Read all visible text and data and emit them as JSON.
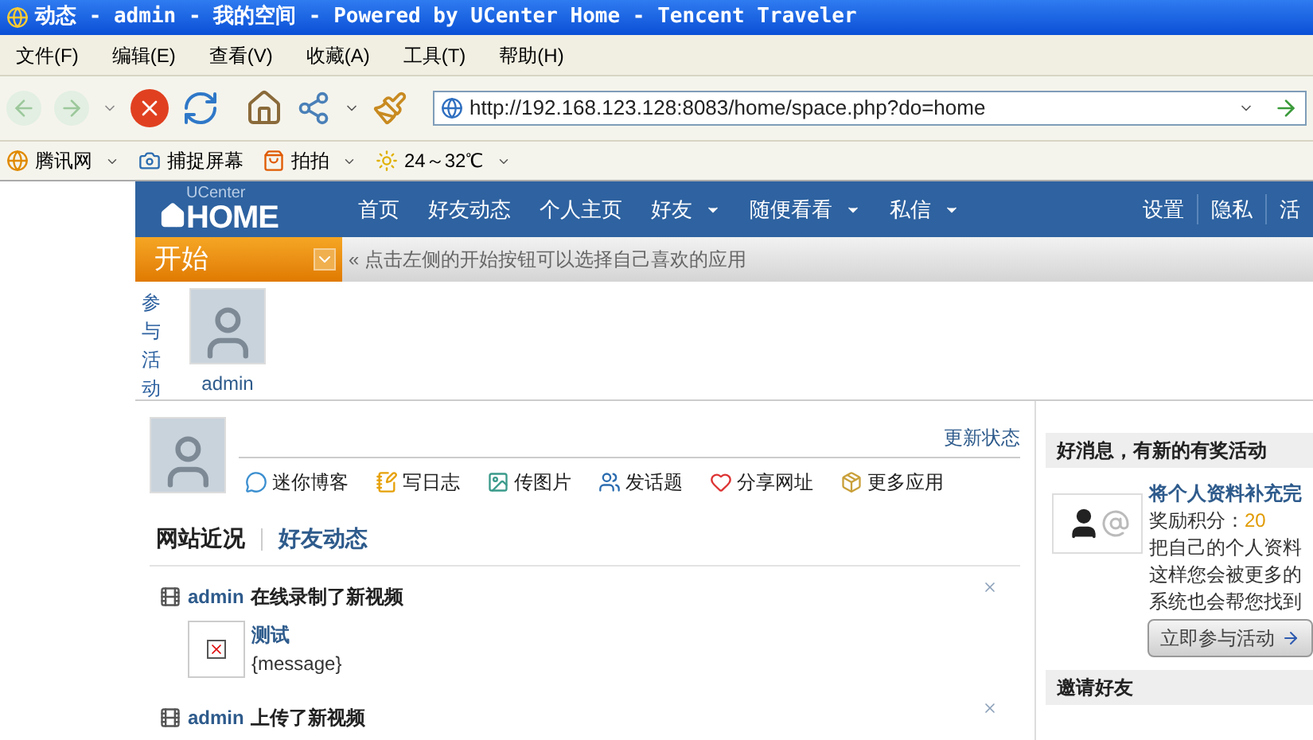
{
  "window": {
    "title": "动态 - admin - 我的空间 - Powered by UCenter Home - Tencent Traveler"
  },
  "menu": [
    "文件(F)",
    "编辑(E)",
    "查看(V)",
    "收藏(A)",
    "工具(T)",
    "帮助(H)"
  ],
  "address": "http://192.168.123.128:8083/home/space.php?do=home",
  "links": [
    {
      "label": "腾讯网",
      "dropdown": true
    },
    {
      "label": "捕捉屏幕",
      "dropdown": false
    },
    {
      "label": "拍拍",
      "dropdown": true
    },
    {
      "label": "24～32℃",
      "dropdown": true
    }
  ],
  "nav": {
    "logo_small": "UCenter",
    "logo": "HOME",
    "items": [
      {
        "label": "首页",
        "dropdown": false
      },
      {
        "label": "好友动态",
        "dropdown": false
      },
      {
        "label": "个人主页",
        "dropdown": false
      },
      {
        "label": "好友",
        "dropdown": true
      },
      {
        "label": "随便看看",
        "dropdown": true
      },
      {
        "label": "私信",
        "dropdown": true
      }
    ],
    "right": [
      "设置",
      "隐私",
      "活"
    ]
  },
  "start": {
    "label": "开始",
    "hint": "« 点击左侧的开始按钮可以选择自己喜欢的应用"
  },
  "participants": {
    "title": "参与活动",
    "users": [
      "admin"
    ]
  },
  "status": {
    "update_link": "更新状态",
    "actions": [
      "迷你博客",
      "写日志",
      "传图片",
      "发话题",
      "分享网址",
      "更多应用"
    ]
  },
  "feed_tabs": [
    {
      "label": "网站近况",
      "selected": true
    },
    {
      "label": "好友动态",
      "selected": false
    }
  ],
  "feed": [
    {
      "user": "admin",
      "action": "在线录制了新视频",
      "attachment": {
        "title": "测试",
        "body": "{message}"
      }
    },
    {
      "user": "admin",
      "action": "上传了新视频"
    }
  ],
  "sidebar": {
    "promo": {
      "heading": "好消息，有新的有奖活动",
      "title": "将个人资料补充完",
      "reward_label": "奖励积分：",
      "reward": "20",
      "lines": [
        "把自己的个人资料",
        "这样您会被更多的",
        "系统也会帮您找到"
      ],
      "button": "立即参与活动"
    },
    "invite": {
      "heading": "邀请好友"
    }
  }
}
